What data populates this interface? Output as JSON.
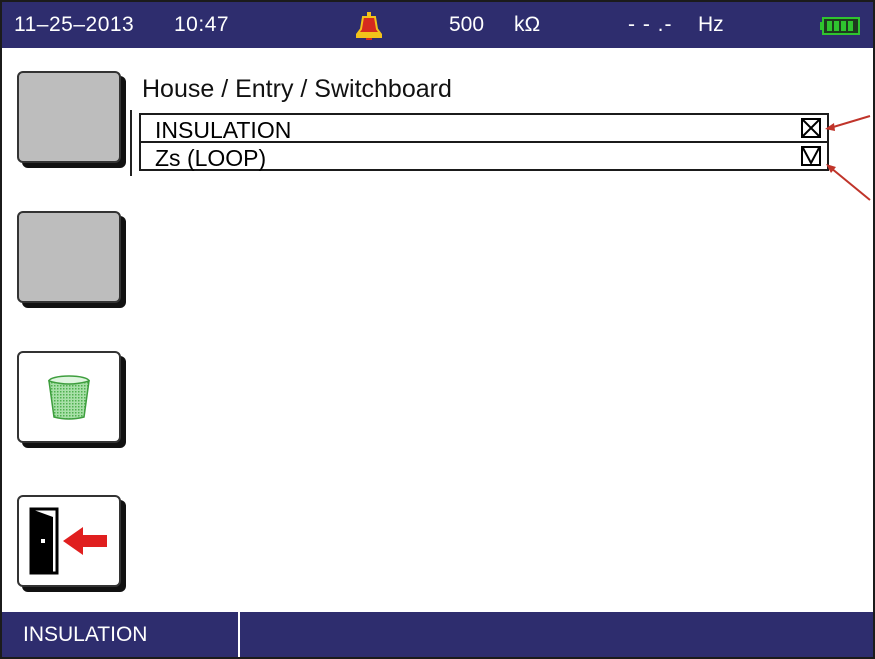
{
  "status": {
    "date": "11–25–2013",
    "time": "10:47",
    "voltage": "500",
    "voltage_unit": "kΩ",
    "frequency": "- - .-",
    "frequency_unit": "Hz",
    "alarm_icon": "alarm-bell-icon",
    "battery_icon": "battery-full-icon"
  },
  "colors": {
    "bar": "#2e2d6e",
    "alarm": "#d62a1e",
    "battery": "#2fc42f",
    "trash": "#6ec96e",
    "arrow": "#c0342a"
  },
  "side_buttons": [
    {
      "icon": "blank"
    },
    {
      "icon": "blank"
    },
    {
      "icon": "trash-bin-icon"
    },
    {
      "icon": "exit-door-icon"
    }
  ],
  "breadcrumb": "House / Entry / Switchboard",
  "tests": [
    {
      "label": "INSULATION",
      "checkbox": "crossed"
    },
    {
      "label": "Zs (LOOP)",
      "checkbox": "checked"
    }
  ],
  "bottom_bar": {
    "active_tab": "INSULATION"
  }
}
